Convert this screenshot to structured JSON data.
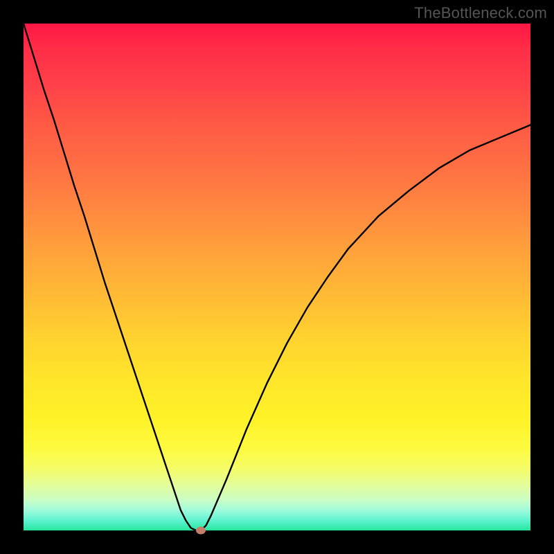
{
  "watermark": "TheBottleneck.com",
  "chart_data": {
    "type": "line",
    "title": "",
    "xlabel": "",
    "ylabel": "",
    "xlim": [
      0,
      100
    ],
    "ylim": [
      0,
      100
    ],
    "x": [
      0,
      2,
      4,
      6,
      8,
      10,
      12,
      14,
      16,
      18,
      20,
      22,
      24,
      26,
      28,
      30,
      31,
      32,
      33,
      34,
      35,
      36,
      37,
      40,
      44,
      48,
      52,
      56,
      60,
      64,
      70,
      76,
      82,
      88,
      94,
      100
    ],
    "values": [
      100,
      93.5,
      87,
      81,
      74.5,
      68,
      62,
      55.5,
      49,
      43,
      37,
      31,
      25,
      19,
      13,
      7,
      4,
      2,
      0.5,
      0,
      0,
      1,
      3,
      10,
      20,
      29,
      37,
      44,
      50,
      55.5,
      62,
      67,
      71.5,
      75,
      77.5,
      80
    ],
    "marker": {
      "x": 35,
      "y": 0
    },
    "colors": {
      "gradient_top": "#ff1744",
      "gradient_mid": "#ffd22f",
      "gradient_bottom": "#25e69e",
      "frame": "#000000",
      "line": "#000000",
      "marker": "#c47e6a"
    }
  }
}
